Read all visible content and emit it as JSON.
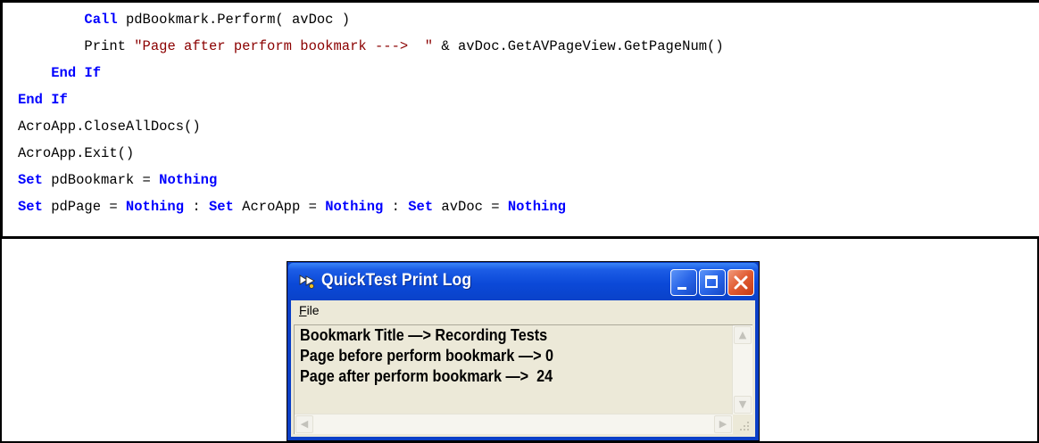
{
  "code": {
    "line1": {
      "kw": "Call",
      "text": " pdBookmark.Perform( avDoc )"
    },
    "line2": {
      "a": "Print ",
      "str": "\"Page after perform bookmark --->  \"",
      "b": " & avDoc.GetAVPageView.GetPageNum()"
    },
    "line3": {
      "kw1": "End",
      "kw2": "If"
    },
    "line4": {
      "kw1": "End",
      "kw2": "If"
    },
    "line5": "AcroApp.CloseAllDocs()",
    "line6": "AcroApp.Exit()",
    "line7": {
      "kw1": "Set",
      "a": " pdBookmark = ",
      "kw2": "Nothing"
    },
    "line8": {
      "kw1": "Set",
      "a": " pdPage = ",
      "kw2": "Nothing",
      "b": " : ",
      "kw3": "Set",
      "c": " AcroApp = ",
      "kw4": "Nothing",
      "d": " : ",
      "kw5": "Set",
      "e": " avDoc = ",
      "kw6": "Nothing"
    }
  },
  "window": {
    "title": "QuickTest Print Log",
    "icon": "quicktest-app-icon",
    "menu": {
      "file_first": "F",
      "file_rest": "ile"
    },
    "log_lines": [
      "Bookmark Title —> Recording Tests",
      "Page before perform bookmark —> 0",
      "Page after perform bookmark —>  24"
    ]
  },
  "colors": {
    "keyword": "#0000ff",
    "string": "#8b0000",
    "titlebar": "#0b49d8",
    "close": "#e05a30"
  }
}
